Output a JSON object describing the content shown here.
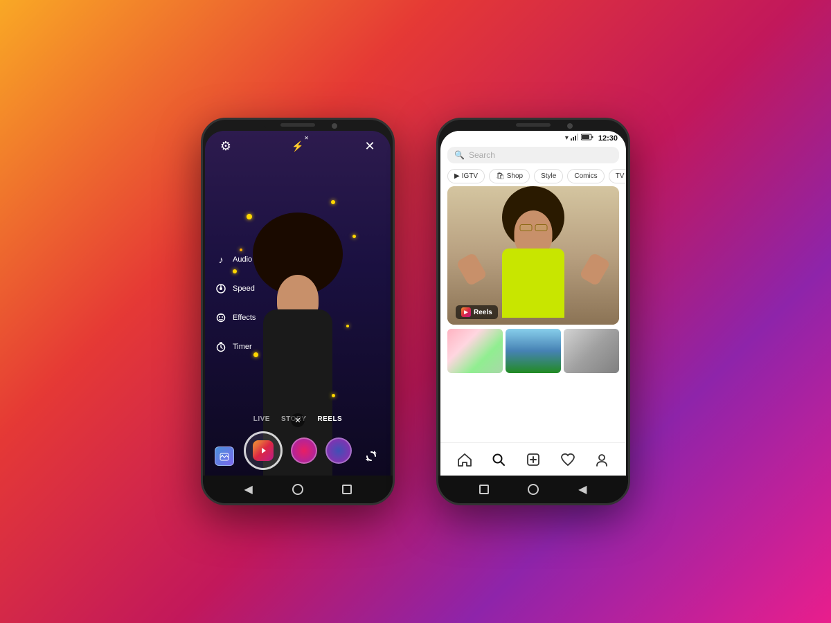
{
  "background": {
    "gradient_start": "#f9a825",
    "gradient_end": "#8e24aa"
  },
  "left_phone": {
    "mode": "reels_camera",
    "top_bar": {
      "settings_icon": "⚙",
      "flash_icon": "⚡",
      "flash_off": "✕",
      "close_icon": "✕"
    },
    "sidebar_items": [
      {
        "icon": "♪",
        "label": "Audio"
      },
      {
        "icon": "⏸",
        "label": "Speed"
      },
      {
        "icon": "😊",
        "label": "Effects"
      },
      {
        "icon": "⏱",
        "label": "Timer"
      }
    ],
    "mode_options": [
      "LIVE",
      "STORY",
      "REELS"
    ],
    "active_mode": "REELS",
    "capture_close": "✕",
    "flip_camera_icon": "↻",
    "nav": {
      "back": "◀",
      "home": "●",
      "recent": "■"
    }
  },
  "right_phone": {
    "mode": "explore",
    "status_bar": {
      "wifi_icon": "▾",
      "signal_icon": "▲",
      "battery_icon": "🔋",
      "time": "12:30"
    },
    "search": {
      "placeholder": "Search",
      "icon": "🔍"
    },
    "chips": [
      {
        "icon": "▶",
        "label": "IGTV"
      },
      {
        "icon": "🛍",
        "label": "Shop"
      },
      {
        "icon": "",
        "label": "Style"
      },
      {
        "icon": "",
        "label": "Comics"
      },
      {
        "icon": "",
        "label": "TV & Movies"
      }
    ],
    "video": {
      "reels_label": "Reels",
      "reels_icon": "▶"
    },
    "bottom_nav": [
      {
        "icon": "⌂",
        "label": "home",
        "active": false
      },
      {
        "icon": "⌕",
        "label": "search",
        "active": true
      },
      {
        "icon": "+",
        "label": "create",
        "active": false
      },
      {
        "icon": "♡",
        "label": "activity",
        "active": false
      },
      {
        "icon": "◯",
        "label": "profile",
        "active": false
      }
    ],
    "nav": {
      "recent": "■",
      "home": "●",
      "back": "◀"
    }
  }
}
